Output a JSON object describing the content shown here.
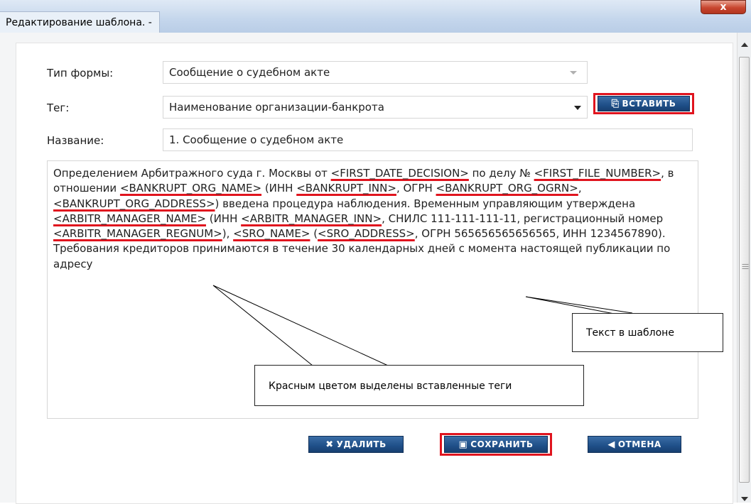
{
  "window": {
    "title": "Редактирование шаблона. -",
    "close_label": "x"
  },
  "form": {
    "type_label": "Тип формы:",
    "type_value": "Сообщение о судебном акте",
    "tag_label": "Тег:",
    "tag_value": "Наименование организации-банкрота",
    "insert_label": "ВСТАВИТЬ",
    "name_label": "Название:",
    "name_value": "1. Сообщение о судебном акте"
  },
  "template_text": [
    {
      "t": "Определением Арбитражного суда г. Москвы от "
    },
    {
      "t": "<FIRST_DATE_DECISION>",
      "tag": true
    },
    {
      "t": " по делу № "
    },
    {
      "t": "<FIRST_FILE_NUMBER>",
      "tag": true
    },
    {
      "t": ", в отношении "
    },
    {
      "t": "<BANKRUPT_ORG_NAME>",
      "tag": true
    },
    {
      "t": " (ИНН "
    },
    {
      "t": "<BANKRUPT_INN>",
      "tag": true
    },
    {
      "t": ", ОГРН "
    },
    {
      "t": "<BANKRUPT_ORG_OGRN>",
      "tag": true
    },
    {
      "t": ", "
    },
    {
      "t": "<BANKRUPT_ORG_ADDRESS>",
      "tag": true
    },
    {
      "t": ") введена процедура наблюдения. Временным управляющим утверждена "
    },
    {
      "t": "<ARBITR_MANAGER_NAME>",
      "tag": true
    },
    {
      "t": " (ИНН "
    },
    {
      "t": "<ARBITR_MANAGER_INN>",
      "tag": true
    },
    {
      "t": ", СНИЛС 111-111-111-11, регистрационный номер "
    },
    {
      "t": "<ARBITR_MANAGER_REGNUM>",
      "tag": true
    },
    {
      "t": "), "
    },
    {
      "t": "<SRO_NAME>",
      "tag": true
    },
    {
      "t": "  ("
    },
    {
      "t": "<SRO_ADDRESS>",
      "tag": true
    },
    {
      "t": ", ОГРН 565656565656565, ИНН 1234567890). Требования кредиторов принимаются в течение 30 календарных дней с момента настоящей публикации по адресу"
    }
  ],
  "buttons": {
    "delete_label": "УДАЛИТЬ",
    "save_label": "СОХРАНИТЬ",
    "cancel_label": "ОТМЕНА"
  },
  "callouts": {
    "text_label": "Текст в шаблоне",
    "tags_label": "Красным цветом выделены вставленные теги"
  },
  "colors": {
    "highlight": "#e0141e",
    "button": "#1f4f88"
  }
}
